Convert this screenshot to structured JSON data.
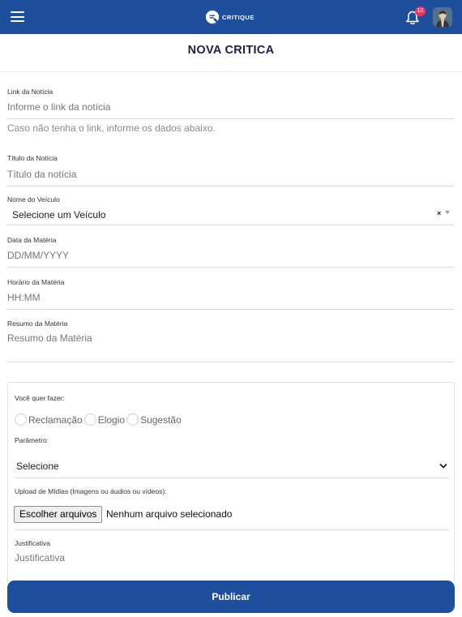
{
  "header": {
    "logo_text": "CRITIQUE",
    "notification_count": "10",
    "colors": {
      "bar": "#1f4e9c",
      "badge": "#e8336b"
    },
    "icons": [
      "menu-icon",
      "logo-icon",
      "bell-icon",
      "avatar"
    ]
  },
  "page": {
    "title": "NOVA CRITICA"
  },
  "form": {
    "link": {
      "label": "Link da Notícia",
      "placeholder": "Informe o link da notícia",
      "hint": "Caso não tenha o link, informe os dados abaixo."
    },
    "titulo": {
      "label": "Título da Notícia",
      "placeholder": "Título da notícia"
    },
    "veiculo": {
      "label": "Nome do Veículo",
      "value": "Selecione um Veículo",
      "clear": "×"
    },
    "data": {
      "label": "Data da Matéria",
      "placeholder": "DD/MM/YYYY"
    },
    "horario": {
      "label": "Horário da Matéria",
      "placeholder": "HH:MM"
    },
    "resumo": {
      "label": "Resumo da Matéria",
      "placeholder": "Resumo da Matéria"
    }
  },
  "card": {
    "tipo_label": "Você quer fazer:",
    "options": [
      "Reclamação",
      "Elogio",
      "Sugestão"
    ],
    "parametro_label": "Parâmetro:",
    "parametro_value": "Selecione",
    "upload_label": "Upload de Mídias (Imagens ou áudios ou vídeos):",
    "file_button": "Escolher arquivos",
    "file_status": "Nenhum arquivo selecionado",
    "justificativa_label": "Justificativa",
    "justificativa_placeholder": "Justificativa"
  },
  "actions": {
    "publish": "Publicar"
  }
}
